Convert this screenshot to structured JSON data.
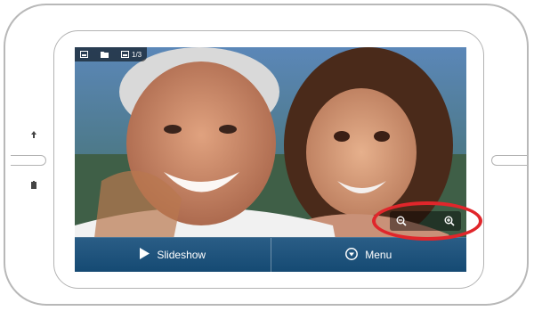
{
  "device": {
    "left_key_top_icon": "arrow-up-icon",
    "left_key_bottom_icon": "battery-icon"
  },
  "screen": {
    "top_bar": {
      "items": [
        {
          "icon": "photo-icon"
        },
        {
          "icon": "folder-icon"
        },
        {
          "icon": "photo-icon",
          "label": "1/3"
        }
      ]
    },
    "zoom": {
      "out_icon": "zoom-out-icon",
      "in_icon": "zoom-in-icon"
    },
    "bottom_bar": {
      "slideshow_label": "Slideshow",
      "slideshow_icon": "play-icon",
      "menu_label": "Menu",
      "menu_icon": "chevron-down-circle-icon"
    }
  },
  "colors": {
    "bar_blue": "#1c527c",
    "highlight_red": "#e0262b"
  }
}
